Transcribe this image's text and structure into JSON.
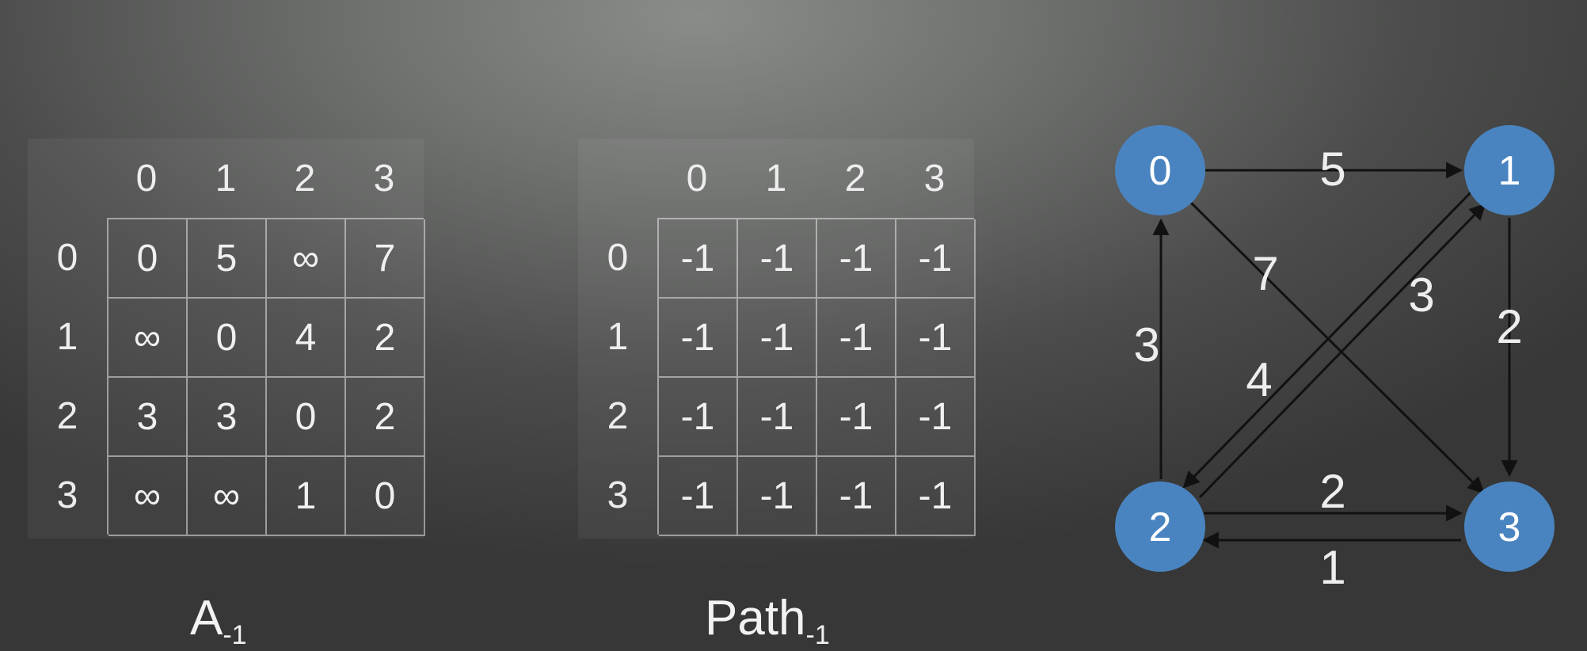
{
  "matrix_a": {
    "caption_main": "A",
    "caption_sub": "-1",
    "columns": [
      "0",
      "1",
      "2",
      "3"
    ],
    "rows": [
      "0",
      "1",
      "2",
      "3"
    ],
    "cells": [
      [
        "0",
        "5",
        "∞",
        "7"
      ],
      [
        "∞",
        "0",
        "4",
        "2"
      ],
      [
        "3",
        "3",
        "0",
        "2"
      ],
      [
        "∞",
        "∞",
        "1",
        "0"
      ]
    ]
  },
  "matrix_path": {
    "caption_main": "Path",
    "caption_sub": "-1",
    "columns": [
      "0",
      "1",
      "2",
      "3"
    ],
    "rows": [
      "0",
      "1",
      "2",
      "3"
    ],
    "cells": [
      [
        "-1",
        "-1",
        "-1",
        "-1"
      ],
      [
        "-1",
        "-1",
        "-1",
        "-1"
      ],
      [
        "-1",
        "-1",
        "-1",
        "-1"
      ],
      [
        "-1",
        "-1",
        "-1",
        "-1"
      ]
    ]
  },
  "graph": {
    "node_color": "#4a84c0",
    "nodes": [
      {
        "id": "0",
        "label": "0"
      },
      {
        "id": "1",
        "label": "1"
      },
      {
        "id": "2",
        "label": "2"
      },
      {
        "id": "3",
        "label": "3"
      }
    ],
    "edges": [
      {
        "from": "0",
        "to": "1",
        "weight": "5"
      },
      {
        "from": "0",
        "to": "3",
        "weight": "7"
      },
      {
        "from": "1",
        "to": "2",
        "weight": "4"
      },
      {
        "from": "1",
        "to": "3",
        "weight": "2"
      },
      {
        "from": "2",
        "to": "0",
        "weight": "3"
      },
      {
        "from": "2",
        "to": "1",
        "weight": "3"
      },
      {
        "from": "2",
        "to": "3",
        "weight": "2"
      },
      {
        "from": "3",
        "to": "2",
        "weight": "1"
      }
    ]
  }
}
